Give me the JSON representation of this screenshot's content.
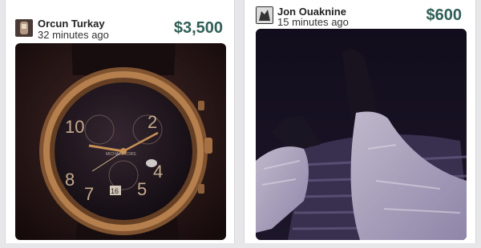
{
  "listings": [
    {
      "user": "Orcun Turkay",
      "time": "32 minutes ago",
      "price": "$3,500",
      "photo_icon": "wristwatch-photo",
      "watch_face": {
        "numerals": [
          "10",
          "2",
          "8",
          "4",
          "7",
          "5"
        ],
        "date_window": "16",
        "brand_text": "MICHAEL KORS"
      }
    },
    {
      "user": "Jon Ouaknine",
      "time": "15 minutes ago",
      "price": "$600",
      "photo_icon": "boots-and-jeans-photo"
    }
  ],
  "colors": {
    "price": "#2f5f55",
    "card_bg": "#ffffff",
    "page_bg": "#e7e7e9"
  }
}
